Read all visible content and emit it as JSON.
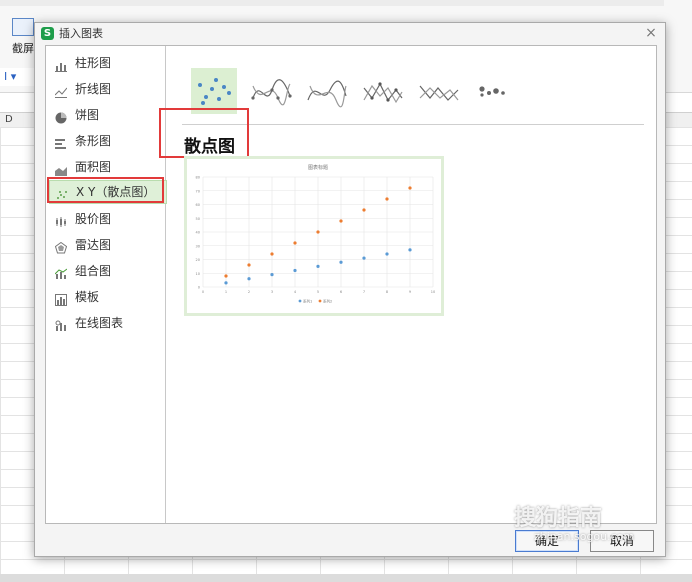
{
  "background": {
    "screenshot_label": "截屏",
    "column_header": "D"
  },
  "dialog": {
    "title": "插入图表",
    "close": "×",
    "sidebar": [
      {
        "label": "柱形图",
        "icon": "column-chart-icon"
      },
      {
        "label": "折线图",
        "icon": "line-chart-icon"
      },
      {
        "label": "饼图",
        "icon": "pie-chart-icon"
      },
      {
        "label": "条形图",
        "icon": "bar-chart-icon"
      },
      {
        "label": "面积图",
        "icon": "area-chart-icon"
      },
      {
        "label": "X Y（散点图）",
        "icon": "scatter-chart-icon"
      },
      {
        "label": "股价图",
        "icon": "stock-chart-icon"
      },
      {
        "label": "雷达图",
        "icon": "radar-chart-icon"
      },
      {
        "label": "组合图",
        "icon": "combo-chart-icon"
      },
      {
        "label": "模板",
        "icon": "template-icon"
      },
      {
        "label": "在线图表",
        "icon": "online-chart-icon"
      }
    ],
    "selected_index": 5,
    "subtypes": [
      "scatter",
      "smooth-lines-markers",
      "smooth-lines",
      "straight-lines-markers",
      "straight-lines",
      "bubble"
    ],
    "selected_subtype": 0,
    "type_title": "散点图",
    "buttons": {
      "ok": "确定",
      "cancel": "取消"
    }
  },
  "preview_chart": {
    "chart_data": {
      "type": "scatter",
      "title": "图表标题",
      "x": [
        1,
        2,
        3,
        4,
        5,
        6,
        7,
        8,
        9
      ],
      "series": [
        {
          "name": "系列1",
          "values": [
            3,
            6,
            9,
            12,
            15,
            18,
            21,
            24,
            27
          ],
          "color": "#5b9bd5"
        },
        {
          "name": "系列2",
          "values": [
            8,
            16,
            24,
            32,
            40,
            48,
            56,
            64,
            72
          ],
          "color": "#ed7d31"
        }
      ],
      "xlim": [
        0,
        10
      ],
      "ylim": [
        0,
        80
      ],
      "grid": true,
      "legend": "bottom"
    }
  },
  "watermark": {
    "brand": "搜狗指南",
    "url": "zhinan.sogou.com"
  }
}
